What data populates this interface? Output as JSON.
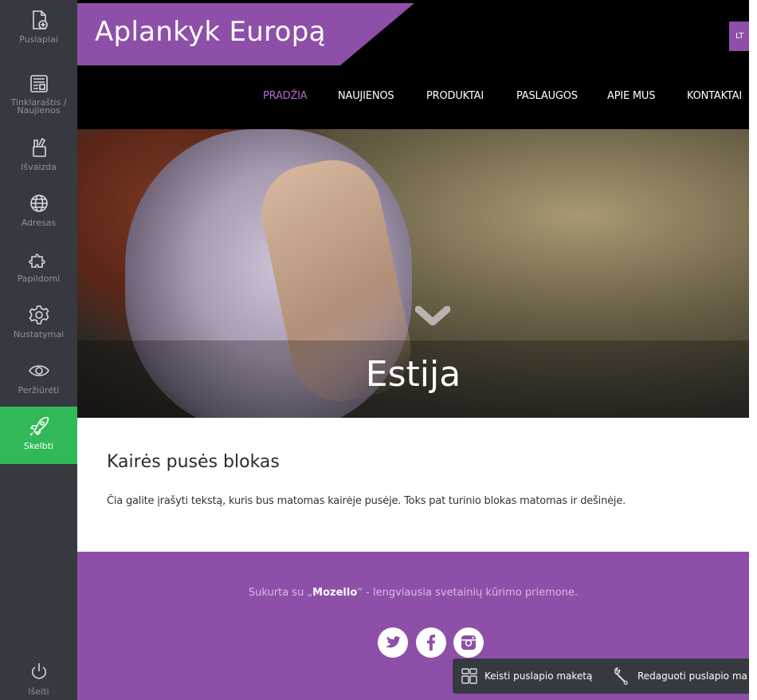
{
  "sidebar": {
    "items": [
      {
        "label": "Puslapiai",
        "icon": "pages-add-icon"
      },
      {
        "label": "Tinklaraštis /\nNaujienos",
        "icon": "blog-icon"
      },
      {
        "label": "Išvaizda",
        "icon": "design-brush-icon"
      },
      {
        "label": "Adresas",
        "icon": "globe-icon"
      },
      {
        "label": "Papildomi",
        "icon": "puzzle-icon"
      },
      {
        "label": "Nustatymai",
        "icon": "gear-icon"
      },
      {
        "label": "Peržiūrėti",
        "icon": "eye-icon"
      },
      {
        "label": "Skelbti",
        "icon": "rocket-icon"
      }
    ],
    "logout_label": "Išeiti",
    "publish_color": "#31b957"
  },
  "site": {
    "logo": "Aplankyk Europą",
    "lang_button": "LT",
    "nav": [
      "PRADŽIA",
      "NAUJIENOS",
      "PRODUKTAI",
      "PASLAUGOS",
      "APIE MUS",
      "KONTAKTAI"
    ],
    "active_nav": "PRADŽIA",
    "accent_color": "#8e4fa8",
    "hero_title": "Estija",
    "content": {
      "heading": "Kairės pusės blokas",
      "text": "Čia galite įrašyti tekstą, kuris bus matomas kairėje pusėje. Toks pat turinio blokas matomas ir dešinėje."
    },
    "footer": {
      "credit_prefix": "Sukurta su „",
      "credit_brand": "Mozello",
      "credit_suffix": "“ - lengviausia svetainių kūrimo priemone.",
      "social": [
        "twitter-icon",
        "facebook-icon",
        "instagram-icon"
      ]
    }
  },
  "floating_toolbar": {
    "change_layout": "Keisti puslapio maketą",
    "edit_page": "Redaguoti puslapio ma"
  }
}
